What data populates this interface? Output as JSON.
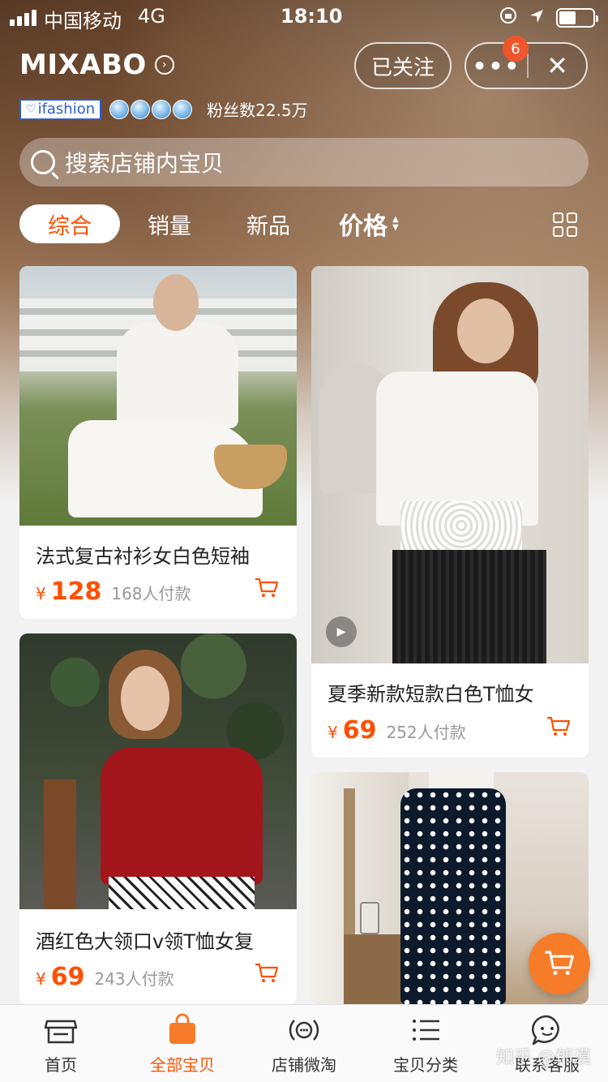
{
  "status_bar": {
    "carrier": "中国移动",
    "network": "4G",
    "time": "18:10"
  },
  "shop": {
    "name": "MIXABO",
    "follow_label": "已关注",
    "menu_badge": "6",
    "brand_tag": "ifashion",
    "fans": "粉丝数22.5万"
  },
  "search": {
    "placeholder": "搜索店铺内宝贝"
  },
  "sort_tabs": [
    {
      "label": "综合"
    },
    {
      "label": "销量"
    },
    {
      "label": "新品"
    },
    {
      "label": "价格"
    }
  ],
  "products": [
    {
      "title": "法式复古衬衫女白色短袖",
      "currency": "¥",
      "price": "128",
      "sales": "168人付款"
    },
    {
      "title": "夏季新款短款白色T恤女",
      "currency": "¥",
      "price": "69",
      "sales": "252人付款"
    },
    {
      "title": "酒红色大领口v领T恤女复",
      "currency": "¥",
      "price": "69",
      "sales": "243人付款"
    }
  ],
  "tab_bar": [
    {
      "label": "首页",
      "icon": "shop-icon"
    },
    {
      "label": "全部宝贝",
      "icon": "bag-icon"
    },
    {
      "label": "店铺微淘",
      "icon": "broadcast-icon"
    },
    {
      "label": "宝贝分类",
      "icon": "list-icon"
    },
    {
      "label": "联系客服",
      "icon": "chat-icon"
    }
  ],
  "watermark": "知乎 @郁漠",
  "colors": {
    "accent": "#ff5000",
    "float_cart": "#f77c2a",
    "badge": "#f2552c"
  }
}
